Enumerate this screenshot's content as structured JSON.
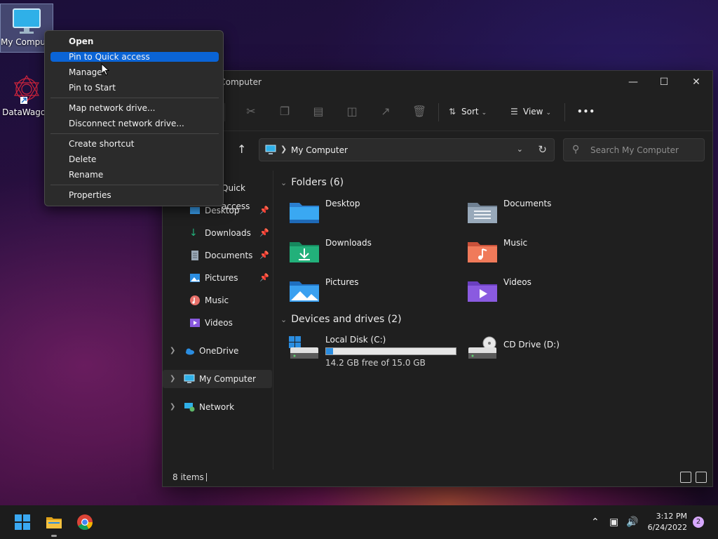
{
  "desktop": {
    "icons": [
      {
        "label": "My Computer",
        "icon": "monitor-icon"
      },
      {
        "label": "DataWagon",
        "icon": "datawagon-logo-icon"
      }
    ]
  },
  "context_menu": {
    "items": [
      {
        "label": "Open",
        "bold": true
      },
      {
        "label": "Pin to Quick access",
        "highlighted": true
      },
      {
        "label": "Manage"
      },
      {
        "label": "Pin to Start"
      },
      {
        "label": "Map network drive..."
      },
      {
        "label": "Disconnect network drive..."
      },
      {
        "label": "Create shortcut"
      },
      {
        "label": "Delete"
      },
      {
        "label": "Rename"
      },
      {
        "label": "Properties"
      }
    ]
  },
  "explorer": {
    "title": "My Computer",
    "toolbar": {
      "sort_label": "Sort",
      "view_label": "View",
      "more_label": "•••"
    },
    "address": {
      "path": "My Computer",
      "search_placeholder": "Search My Computer"
    },
    "nav": {
      "quick_access_label": "Quick access",
      "items": [
        {
          "label": "Desktop",
          "icon": "desktop-folder-icon",
          "pinned": true
        },
        {
          "label": "Downloads",
          "icon": "download-icon",
          "pinned": true
        },
        {
          "label": "Documents",
          "icon": "documents-icon",
          "pinned": true
        },
        {
          "label": "Pictures",
          "icon": "pictures-icon",
          "pinned": true
        },
        {
          "label": "Music",
          "icon": "music-icon",
          "pinned": false
        },
        {
          "label": "Videos",
          "icon": "videos-icon",
          "pinned": false
        }
      ],
      "onedrive_label": "OneDrive",
      "mycomputer_label": "My Computer",
      "network_label": "Network"
    },
    "folders_header": "Folders (6)",
    "folders": [
      {
        "label": "Desktop",
        "color": "#3aa0f0"
      },
      {
        "label": "Documents",
        "color": "#8fa3b8"
      },
      {
        "label": "Downloads",
        "color": "#22b07a"
      },
      {
        "label": "Music",
        "color": "#f07a5a"
      },
      {
        "label": "Pictures",
        "color": "#3aa0f0"
      },
      {
        "label": "Videos",
        "color": "#8a5ae0"
      }
    ],
    "drives_header": "Devices and drives (2)",
    "drives": [
      {
        "label": "Local Disk (C:)",
        "free_text": "14.2 GB free of 15.0 GB",
        "used_fraction": 0.053
      },
      {
        "label": "CD Drive (D:)"
      }
    ],
    "status": {
      "items_count": "8 items"
    }
  },
  "taskbar": {
    "time": "3:12 PM",
    "date": "6/24/2022",
    "notification_count": "2"
  },
  "colors": {
    "accent": "#0a64d6",
    "window_bg": "#1f1f1f"
  }
}
